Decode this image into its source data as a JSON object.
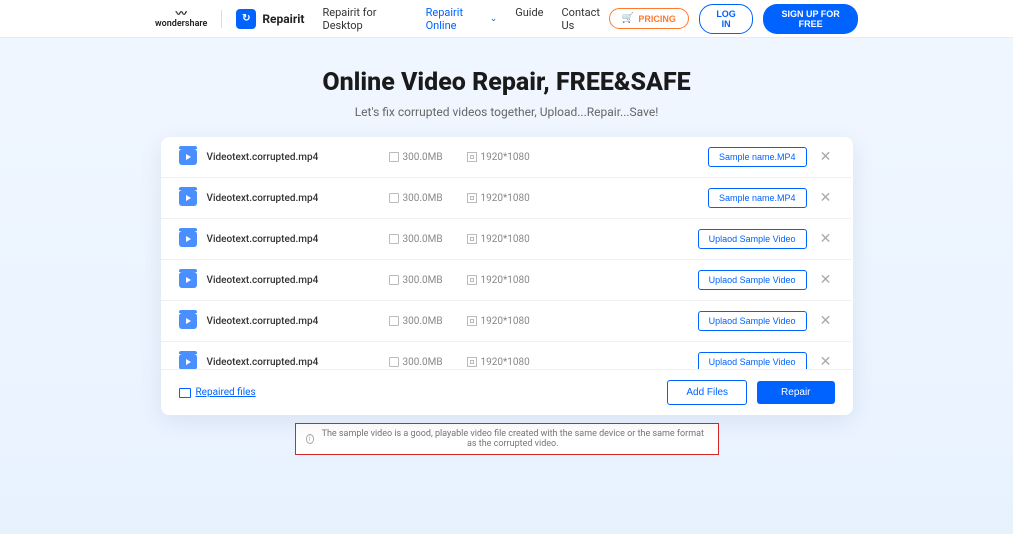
{
  "header": {
    "brand_wondershare": "wondershare",
    "brand_wondershare_icon": "〰",
    "brand_repairit": "Repairit",
    "nav": {
      "desktop": "Repairit for Desktop",
      "online": "Repairit Online",
      "guide": "Guide",
      "contact": "Contact Us"
    },
    "buttons": {
      "pricing": "PRICING",
      "login": "LOG IN",
      "signup": "SIGN UP FOR FREE"
    }
  },
  "hero": {
    "title": "Online Video Repair, FREE&SAFE",
    "subtitle": "Let's fix corrupted videos together, Upload...Repair...Save!"
  },
  "files": [
    {
      "name": "Videotext.corrupted.mp4",
      "size": "300.0MB",
      "res": "1920*1080",
      "action": "Sample name.MP4"
    },
    {
      "name": "Videotext.corrupted.mp4",
      "size": "300.0MB",
      "res": "1920*1080",
      "action": "Sample name.MP4"
    },
    {
      "name": "Videotext.corrupted.mp4",
      "size": "300.0MB",
      "res": "1920*1080",
      "action": "Uplaod Sample Video"
    },
    {
      "name": "Videotext.corrupted.mp4",
      "size": "300.0MB",
      "res": "1920*1080",
      "action": "Uplaod Sample Video"
    },
    {
      "name": "Videotext.corrupted.mp4",
      "size": "300.0MB",
      "res": "1920*1080",
      "action": "Uplaod Sample Video"
    },
    {
      "name": "Videotext.corrupted.mp4",
      "size": "300.0MB",
      "res": "1920*1080",
      "action": "Uplaod Sample Video"
    }
  ],
  "footer": {
    "repaired_link": "Repaired files",
    "add_files": "Add Files",
    "repair": "Repair"
  },
  "info": "The sample video is a good, playable video file created with the same device or the same format as the corrupted video."
}
